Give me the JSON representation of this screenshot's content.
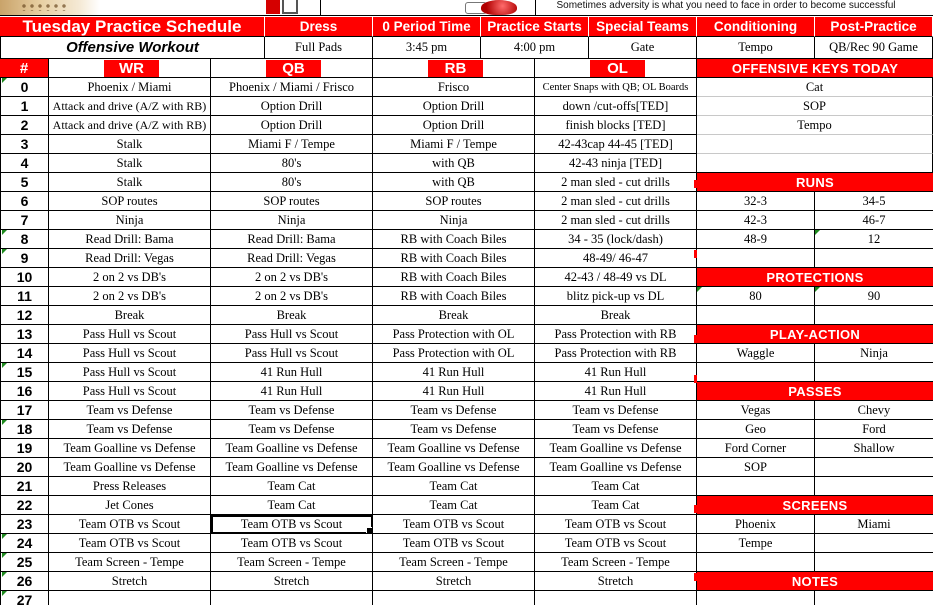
{
  "banner": {
    "motto": "Sometimes adversity is what you need to face in order to become successful",
    "images": [
      "leopard-image",
      "team-logo-image",
      "football-helmet-image"
    ]
  },
  "header": {
    "title": "Tuesday Practice Schedule",
    "subtitle": "Offensive Workout",
    "columns": [
      {
        "label": "Dress",
        "value": "Full Pads"
      },
      {
        "label": "0 Period Time",
        "value": "3:45 pm"
      },
      {
        "label": "Practice Starts",
        "value": "4:00 pm"
      },
      {
        "label": "Special Teams",
        "value": "Gate"
      },
      {
        "label": "Conditioning",
        "value": "Tempo"
      },
      {
        "label": "Post-Practice",
        "value": "QB/Rec 90 Game"
      }
    ]
  },
  "schedule": {
    "headers": {
      "num": "#",
      "wr": "WR",
      "qb": "QB",
      "rb": "RB",
      "ol": "OL"
    },
    "rows": [
      {
        "n": "0",
        "wr": "Phoenix / Miami",
        "qb": "Phoenix / Miami / Frisco",
        "rb": "Frisco",
        "ol": "Center Snaps with QB; OL Boards"
      },
      {
        "n": "1",
        "wr": "Attack and drive (A/Z with RB)",
        "qb": "Option Drill",
        "rb": "Option Drill",
        "ol": "down /cut-offs[TED]"
      },
      {
        "n": "2",
        "wr": "Attack and drive (A/Z with RB)",
        "qb": "Option Drill",
        "rb": "Option Drill",
        "ol": "finish blocks [TED]"
      },
      {
        "n": "3",
        "wr": "Stalk",
        "qb": "Miami F / Tempe",
        "rb": "Miami F / Tempe",
        "ol": "42-43cap 44-45 [TED]"
      },
      {
        "n": "4",
        "wr": "Stalk",
        "qb": "80's",
        "rb": "with QB",
        "ol": "42-43 ninja [TED]"
      },
      {
        "n": "5",
        "wr": "Stalk",
        "qb": "80's",
        "rb": "with QB",
        "ol": "2 man sled - cut drills"
      },
      {
        "n": "6",
        "wr": "SOP routes",
        "qb": "SOP routes",
        "rb": "SOP routes",
        "ol": "2 man sled - cut drills"
      },
      {
        "n": "7",
        "wr": "Ninja",
        "qb": "Ninja",
        "rb": "Ninja",
        "ol": "2 man sled - cut drills"
      },
      {
        "n": "8",
        "wr": "Read Drill: Bama",
        "qb": "Read Drill: Bama",
        "rb": "RB with Coach Biles",
        "ol": "34 - 35 (lock/dash)"
      },
      {
        "n": "9",
        "wr": "Read Drill: Vegas",
        "qb": "Read Drill: Vegas",
        "rb": "RB with Coach Biles",
        "ol": "48-49/ 46-47"
      },
      {
        "n": "10",
        "wr": "2 on 2 vs DB's",
        "qb": "2 on 2 vs DB's",
        "rb": "RB with Coach Biles",
        "ol": "42-43 / 48-49 vs DL"
      },
      {
        "n": "11",
        "wr": "2 on 2 vs DB's",
        "qb": "2 on 2 vs DB's",
        "rb": "RB with Coach Biles",
        "ol": "blitz pick-up vs DL"
      },
      {
        "n": "12",
        "wr": "Break",
        "qb": "Break",
        "rb": "Break",
        "ol": "Break"
      },
      {
        "n": "13",
        "wr": "Pass Hull vs Scout",
        "qb": "Pass Hull vs Scout",
        "rb": "Pass Protection with OL",
        "ol": "Pass Protection with RB"
      },
      {
        "n": "14",
        "wr": "Pass Hull vs Scout",
        "qb": "Pass Hull vs Scout",
        "rb": "Pass Protection with OL",
        "ol": "Pass Protection with RB"
      },
      {
        "n": "15",
        "wr": "Pass Hull vs Scout",
        "qb": "41 Run Hull",
        "rb": "41 Run Hull",
        "ol": "41 Run Hull"
      },
      {
        "n": "16",
        "wr": "Pass Hull vs Scout",
        "qb": "41 Run Hull",
        "rb": "41 Run Hull",
        "ol": "41 Run Hull"
      },
      {
        "n": "17",
        "wr": "Team vs Defense",
        "qb": "Team vs Defense",
        "rb": "Team vs Defense",
        "ol": "Team vs Defense"
      },
      {
        "n": "18",
        "wr": "Team vs Defense",
        "qb": "Team vs Defense",
        "rb": "Team vs Defense",
        "ol": "Team vs Defense"
      },
      {
        "n": "19",
        "wr": "Team Goalline vs Defense",
        "qb": "Team Goalline vs Defense",
        "rb": "Team Goalline vs Defense",
        "ol": "Team Goalline vs Defense"
      },
      {
        "n": "20",
        "wr": "Team Goalline vs Defense",
        "qb": "Team Goalline vs Defense",
        "rb": "Team Goalline vs Defense",
        "ol": "Team Goalline vs Defense"
      },
      {
        "n": "21",
        "wr": "Press Releases",
        "qb": "Team Cat",
        "rb": "Team Cat",
        "ol": "Team Cat"
      },
      {
        "n": "22",
        "wr": "Jet Cones",
        "qb": "Team Cat",
        "rb": "Team Cat",
        "ol": "Team Cat"
      },
      {
        "n": "23",
        "wr": "Team OTB vs Scout",
        "qb": "Team OTB vs Scout",
        "rb": "Team OTB vs Scout",
        "ol": "Team OTB vs Scout"
      },
      {
        "n": "24",
        "wr": "Team OTB vs Scout",
        "qb": "Team OTB vs Scout",
        "rb": "Team OTB vs Scout",
        "ol": "Team OTB vs Scout"
      },
      {
        "n": "25",
        "wr": "Team Screen - Tempe",
        "qb": "Team Screen - Tempe",
        "rb": "Team Screen - Tempe",
        "ol": "Team Screen - Tempe"
      },
      {
        "n": "26",
        "wr": "Stretch",
        "qb": "Stretch",
        "rb": "Stretch",
        "ol": "Stretch"
      },
      {
        "n": "27",
        "wr": "",
        "qb": "",
        "rb": "",
        "ol": ""
      }
    ]
  },
  "sidebar": {
    "keys_title": "OFFENSIVE KEYS TODAY",
    "keys": [
      "Cat",
      "SOP",
      "Tempo",
      "",
      ""
    ],
    "sections": [
      {
        "title": "RUNS",
        "rows": [
          [
            "32-3",
            "34-5"
          ],
          [
            "42-3",
            "46-7"
          ],
          [
            "48-9",
            "12"
          ],
          [
            "",
            ""
          ]
        ]
      },
      {
        "title": "PROTECTIONS",
        "rows": [
          [
            "80",
            "90"
          ],
          [
            "",
            ""
          ]
        ]
      },
      {
        "title": "PLAY-ACTION",
        "rows": [
          [
            "Waggle",
            "Ninja"
          ],
          [
            "",
            ""
          ]
        ]
      },
      {
        "title": "PASSES",
        "rows": [
          [
            "Vegas",
            "Chevy"
          ],
          [
            "Geo",
            "Ford"
          ],
          [
            "Ford Corner",
            "Shallow"
          ],
          [
            "SOP",
            ""
          ],
          [
            "",
            ""
          ]
        ]
      },
      {
        "title": "SCREENS",
        "rows": [
          [
            "Phoenix",
            "Miami"
          ],
          [
            "Tempe",
            ""
          ],
          [
            "",
            ""
          ]
        ]
      },
      {
        "title": "NOTES",
        "rows": [
          [
            "",
            ""
          ]
        ]
      }
    ]
  },
  "colors": {
    "header_red": "#ff0000",
    "comment_marker": "#1e8a1e"
  }
}
